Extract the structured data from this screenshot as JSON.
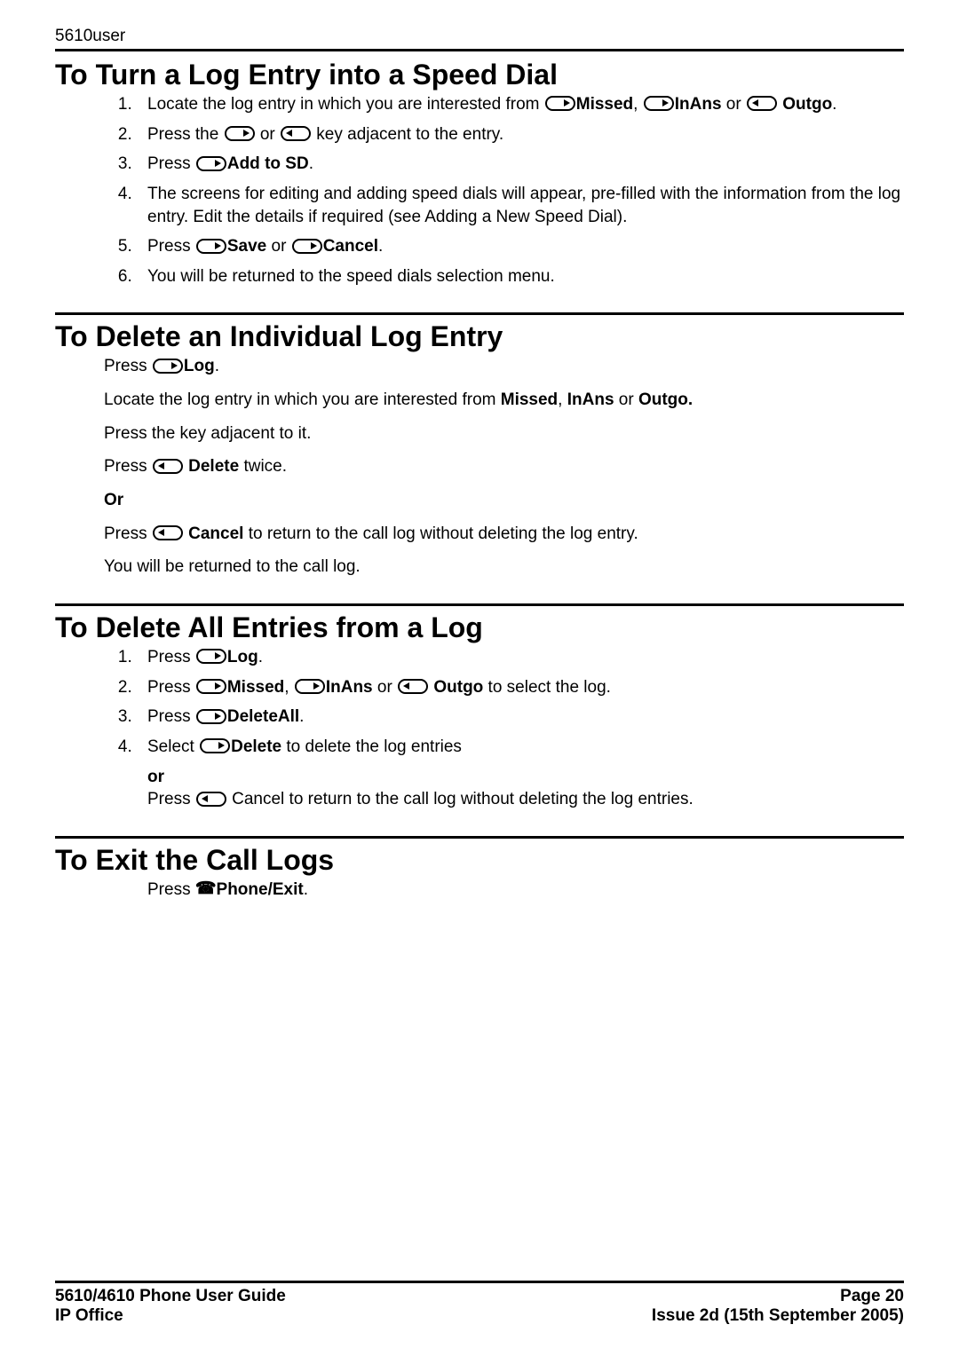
{
  "running_head": "5610user",
  "sections": {
    "turn_speed_dial": {
      "title": "To Turn a Log Entry into a Speed Dial",
      "step1_pre": "Locate the log entry in which you are interested from ",
      "missed": "Missed",
      "comma_sp": ", ",
      "inans": "InAns",
      "or_sp": " or ",
      "outgo": " Outgo",
      "period": ".",
      "step2_pre": "Press the ",
      "step2_mid": " or ",
      "step2_post": " key adjacent to the entry.",
      "step3_pre": "Press ",
      "step3_b": "Add to SD",
      "step4": "The screens for editing and adding speed dials will appear, pre-filled with the information from the log entry. Edit the details if required (see Adding a New Speed Dial).",
      "step5_pre": "Press ",
      "save": "Save",
      "step5_or": " or ",
      "cancel": "Cancel",
      "step6": "You will be returned to the speed dials selection menu."
    },
    "delete_one": {
      "title": "To Delete an Individual Log Entry",
      "p1_pre": "Press ",
      "log": "Log",
      "p2_pre": "Locate the log entry in which you are interested from ",
      "missed": "Missed",
      "comma_sp": ", ",
      "inans": "InAns",
      "or_sp": " or  ",
      "outgo": "Outgo.",
      "p3": "Press the key adjacent to it.",
      "p4_pre": "Press ",
      "delete": " Delete",
      "p4_post": " twice.",
      "or_label": "Or",
      "p5_pre": "Press ",
      "cancel": " Cancel",
      "p5_post": " to return to the call log without deleting the log entry.",
      "p6": "You will be returned to the call log."
    },
    "delete_all": {
      "title": "To Delete All Entries from a Log",
      "s1_pre": "Press ",
      "log": "Log",
      "s2_pre": "Press ",
      "missed": "Missed",
      "comma_sp": ", ",
      "inans": "InAns",
      "or_sp": " or ",
      "outgo": " Outgo",
      "s2_post": " to select the log.",
      "s3_pre": "Press ",
      "deleteall": "DeleteAll",
      "s4_pre": "Select ",
      "delete": "Delete",
      "s4_post": " to delete the log entries",
      "s4_or": "or",
      "s4_l2_pre": "Press ",
      "s4_l2_post": " Cancel to return to the call log without deleting the log entries."
    },
    "exit": {
      "title": "To Exit the Call Logs",
      "line_pre": "Press ",
      "phone_exit": "Phone/Exit"
    }
  },
  "footer": {
    "left1": "5610/4610 Phone User Guide",
    "left2": "IP Office",
    "right1": "Page 20",
    "right2": "Issue 2d (15th September 2005)"
  }
}
